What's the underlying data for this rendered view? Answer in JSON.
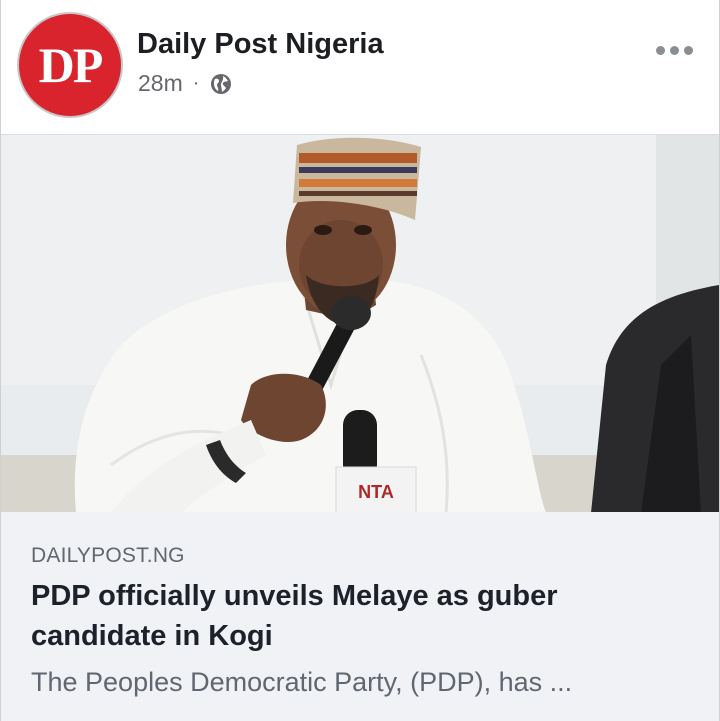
{
  "post": {
    "avatar_text": "DP",
    "page_name": "Daily Post Nigeria",
    "time": "28m",
    "separator": "·",
    "privacy_icon": "globe-icon",
    "menu_icon": "more-options-icon"
  },
  "photo": {
    "mic_flag_text": "NTA"
  },
  "link": {
    "domain": "DAILYPOST.NG",
    "headline": "PDP officially unveils Melaye as guber candidate in Kogi",
    "description": "The Peoples Democratic Party, (PDP), has ..."
  },
  "colors": {
    "brand_red": "#d9232d",
    "text_primary": "#1c1e21",
    "text_secondary": "#65676b",
    "card_bg": "#f0f2f5"
  }
}
